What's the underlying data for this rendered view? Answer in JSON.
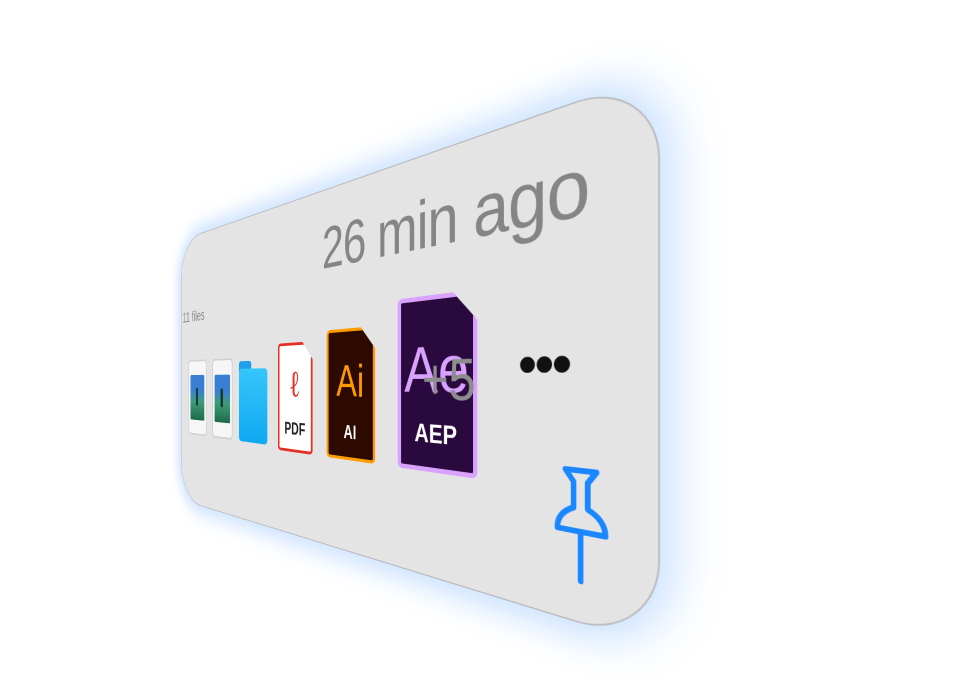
{
  "shelf": {
    "timestamp": "26 min ago",
    "file_count": "11 files",
    "files": [
      {
        "type": "image",
        "icon": "image-file-icon"
      },
      {
        "type": "image",
        "icon": "image-file-icon"
      },
      {
        "type": "folder",
        "icon": "folder-icon",
        "color": "#1aaef5"
      },
      {
        "type": "pdf",
        "glyph": "ℓ",
        "ext": "PDF",
        "accent": "#e53125"
      },
      {
        "type": "ai",
        "glyph": "Ai",
        "ext": "AI",
        "accent": "#ff9a00"
      },
      {
        "type": "aep",
        "glyph": "Ae",
        "ext": "AEP",
        "accent": "#d9a2ff"
      }
    ],
    "more_count": "+5",
    "more_menu": "•••",
    "pin_icon": "pin-icon",
    "accent_color": "#1a86ff"
  }
}
